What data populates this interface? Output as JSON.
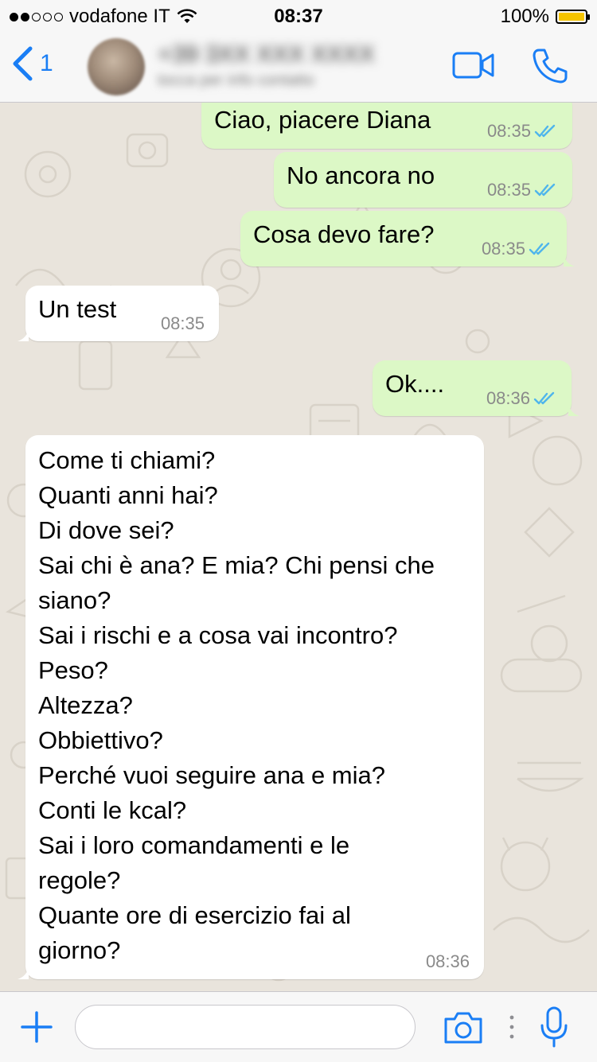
{
  "status_bar": {
    "carrier": "vodafone IT",
    "time": "08:37",
    "battery": "100%",
    "battery_level": 1.0,
    "signal_bars_filled": 2,
    "signal_bars_total": 5
  },
  "nav": {
    "back_count": "1",
    "contact_name": "+39 3XX XXX XXXX",
    "contact_subtitle": "tocca per info contatto"
  },
  "messages": [
    {
      "direction": "out",
      "text": "Ciao, piacere Diana",
      "time": "08:35",
      "read": true
    },
    {
      "direction": "out",
      "text": "No ancora no",
      "time": "08:35",
      "read": true
    },
    {
      "direction": "out",
      "text": "Cosa devo fare?",
      "time": "08:35",
      "read": true
    },
    {
      "direction": "in",
      "text": "Un test",
      "time": "08:35"
    },
    {
      "direction": "out",
      "text": "Ok....",
      "time": "08:36",
      "read": true
    },
    {
      "direction": "in",
      "text": "Come ti chiami?\nQuanti anni hai?\nDi dove sei?\nSai chi è ana? E mia? Chi pensi che\nsiano?\nSai i rischi e a cosa vai incontro?\nPeso?\nAltezza?\nObbiettivo?\nPerché vuoi seguire ana e mia?\nConti le kcal?\nSai i loro comandamenti e le\nregole?\nQuante ore di esercizio fai al\ngiorno?",
      "time": "08:36"
    }
  ],
  "input": {
    "value": "",
    "placeholder": ""
  },
  "colors": {
    "accent": "#1a7ef5",
    "outgoing_bubble": "#dcf8c6",
    "incoming_bubble": "#ffffff",
    "chat_background": "#e9e4dc",
    "read_ticks": "#4fb5ec",
    "battery_fill": "#f5c400"
  },
  "icons": {
    "back": "chevron-left-icon",
    "video_call": "video-camera-icon",
    "voice_call": "phone-icon",
    "attach": "plus-icon",
    "camera": "camera-icon",
    "microphone": "microphone-icon",
    "wifi": "wifi-icon",
    "read_receipt": "double-check-icon"
  }
}
